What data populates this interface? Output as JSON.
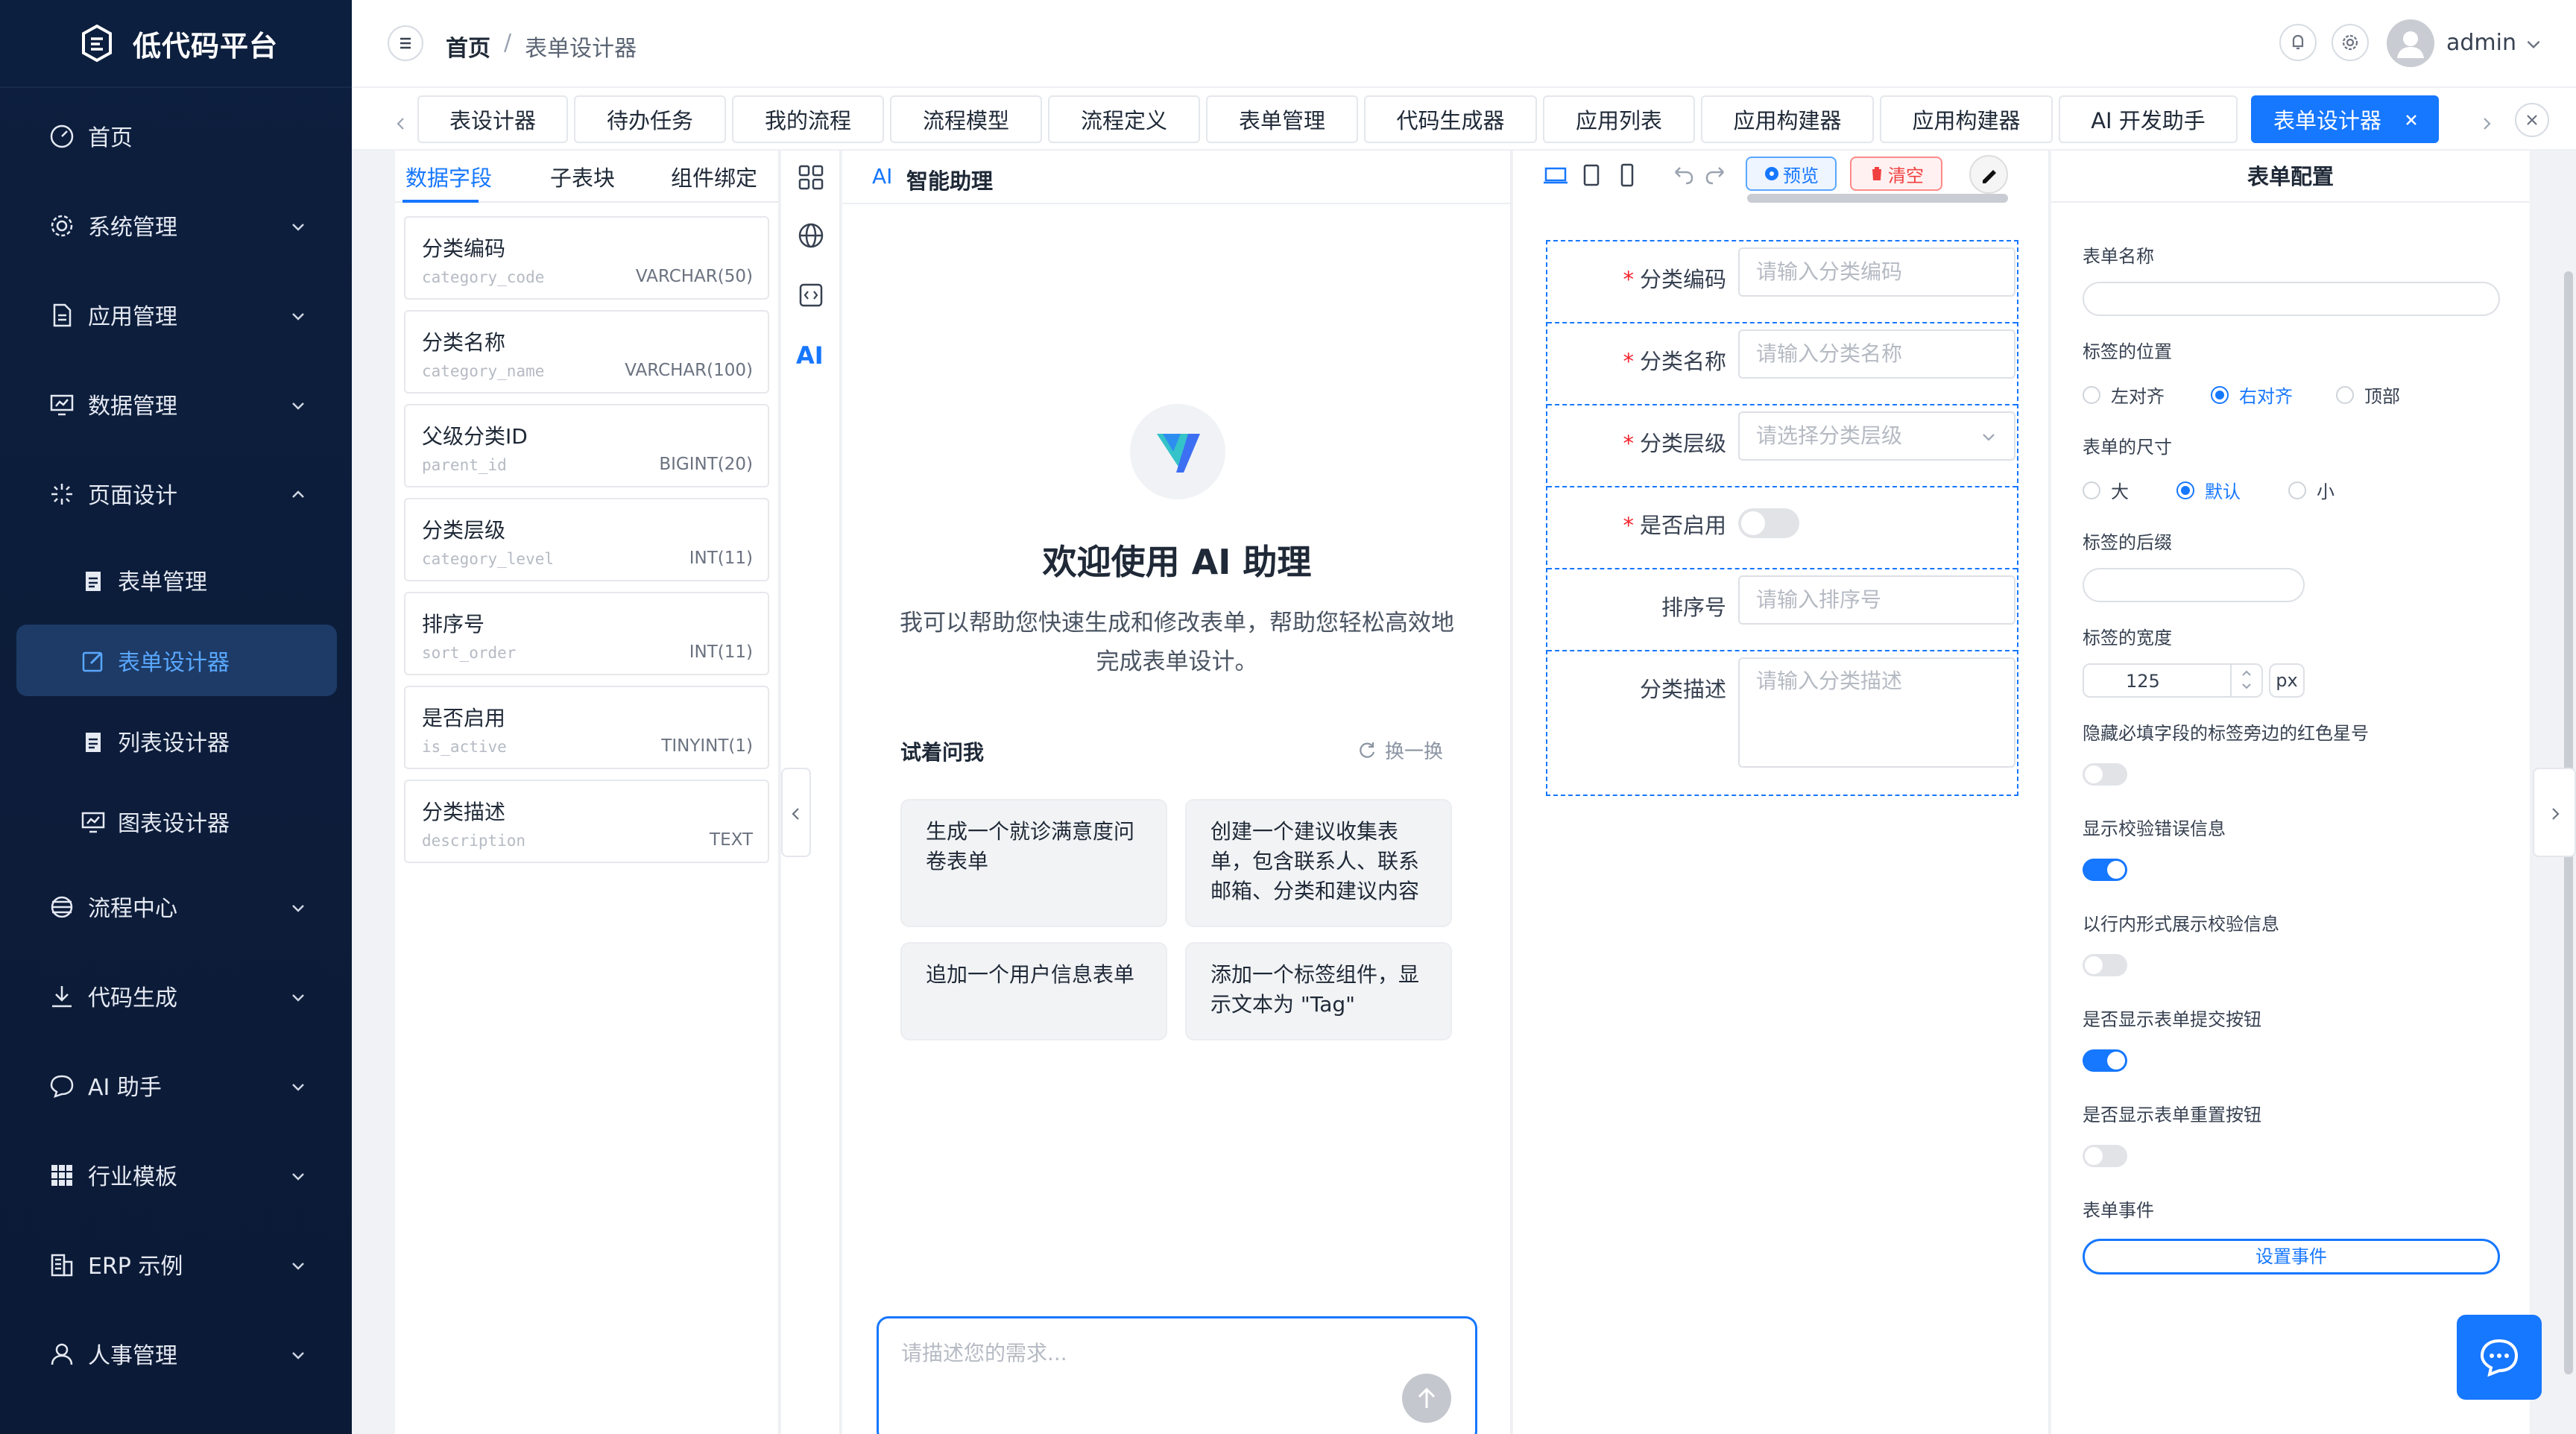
{
  "app": {
    "title": "低代码平台",
    "logo_color": "#ffffff"
  },
  "sidebar": {
    "items": [
      {
        "label": "首页",
        "icon": "dashboard-icon"
      },
      {
        "label": "系统管理",
        "icon": "gear-icon"
      },
      {
        "label": "应用管理",
        "icon": "document-icon"
      },
      {
        "label": "数据管理",
        "icon": "data-icon"
      },
      {
        "label": "页面设计",
        "icon": "sparkle-icon"
      },
      {
        "label": "表单管理",
        "icon": "clipboard-icon"
      },
      {
        "label": "表单设计器",
        "icon": "edit-icon"
      },
      {
        "label": "列表设计器",
        "icon": "clipboard-icon"
      },
      {
        "label": "图表设计器",
        "icon": "chart-icon"
      },
      {
        "label": "流程中心",
        "icon": "flow-icon"
      },
      {
        "label": "代码生成",
        "icon": "download-icon"
      },
      {
        "label": "AI 助手",
        "icon": "chat-icon"
      },
      {
        "label": "行业模板",
        "icon": "grid-icon"
      },
      {
        "label": "ERP 示例",
        "icon": "building-icon"
      },
      {
        "label": "人事管理",
        "icon": "user-icon"
      }
    ]
  },
  "header": {
    "breadcrumb": {
      "home": "首页",
      "separator": "/",
      "current": "表单设计器"
    },
    "username": "admin"
  },
  "tabs": [
    "表设计器",
    "待办任务",
    "我的流程",
    "流程模型",
    "流程定义",
    "表单管理",
    "代码生成器",
    "应用列表",
    "应用构建器",
    "应用构建器",
    "AI 开发助手",
    "表单设计器"
  ],
  "left_panel": {
    "tabs": [
      "数据字段",
      "子表块",
      "组件绑定"
    ],
    "fields": [
      {
        "name": "分类编码",
        "code": "category_code",
        "type": "VARCHAR(50)"
      },
      {
        "name": "分类名称",
        "code": "category_name",
        "type": "VARCHAR(100)"
      },
      {
        "name": "父级分类ID",
        "code": "parent_id",
        "type": "BIGINT(20)"
      },
      {
        "name": "分类层级",
        "code": "category_level",
        "type": "INT(11)"
      },
      {
        "name": "排序号",
        "code": "sort_order",
        "type": "INT(11)"
      },
      {
        "name": "是否启用",
        "code": "is_active",
        "type": "TINYINT(1)"
      },
      {
        "name": "分类描述",
        "code": "description",
        "type": "TEXT"
      }
    ]
  },
  "ai_panel": {
    "badge": "AI",
    "title": "智能助理",
    "welcome": "欢迎使用 AI 助理",
    "desc": "我可以帮助您快速生成和修改表单，帮助您轻松高效地完成表单设计。",
    "try_label": "试着问我",
    "refresh_label": "换一换",
    "suggestions": [
      "生成一个就诊满意度问卷表单",
      "创建一个建议收集表单，包含联系人、联系邮箱、分类和建议内容",
      "追加一个用户信息表单",
      "添加一个标签组件，显示文本为 \"Tag\""
    ],
    "prompt_placeholder": "请描述您的需求..."
  },
  "canvas": {
    "preview_label": "预览",
    "clear_label": "清空",
    "form_rows": [
      {
        "label": "分类编码",
        "required": "*",
        "placeholder": "请输入分类编码",
        "kind": "input"
      },
      {
        "label": "分类名称",
        "required": "*",
        "placeholder": "请输入分类名称",
        "kind": "input"
      },
      {
        "label": "分类层级",
        "required": "*",
        "placeholder": "请选择分类层级",
        "kind": "select"
      },
      {
        "label": "是否启用",
        "required": "*",
        "placeholder": "",
        "kind": "switch"
      },
      {
        "label": "排序号",
        "required": "",
        "placeholder": "请输入排序号",
        "kind": "input"
      },
      {
        "label": "分类描述",
        "required": "",
        "placeholder": "请输入分类描述",
        "kind": "textarea"
      }
    ]
  },
  "config": {
    "title": "表单配置",
    "form_name_label": "表单名称",
    "label_position_label": "标签的位置",
    "label_positions": [
      "左对齐",
      "右对齐",
      "顶部"
    ],
    "label_position_selected": "右对齐",
    "size_label": "表单的尺寸",
    "sizes": [
      "大",
      "默认",
      "小"
    ],
    "size_selected": "默认",
    "suffix_label": "标签的后缀",
    "width_label": "标签的宽度",
    "width_value": "125",
    "width_unit": "px",
    "switches": [
      {
        "label": "隐藏必填字段的标签旁边的红色星号",
        "on": false
      },
      {
        "label": "显示校验错误信息",
        "on": true
      },
      {
        "label": "以行内形式展示校验信息",
        "on": false
      },
      {
        "label": "是否显示表单提交按钮",
        "on": true
      },
      {
        "label": "是否显示表单重置按钮",
        "on": false
      }
    ],
    "events_label": "表单事件",
    "events_button": "设置事件"
  },
  "colors": {
    "primary": "#1677ff",
    "sidebar_bg": "#0d1f3e",
    "danger": "#f5222d"
  }
}
